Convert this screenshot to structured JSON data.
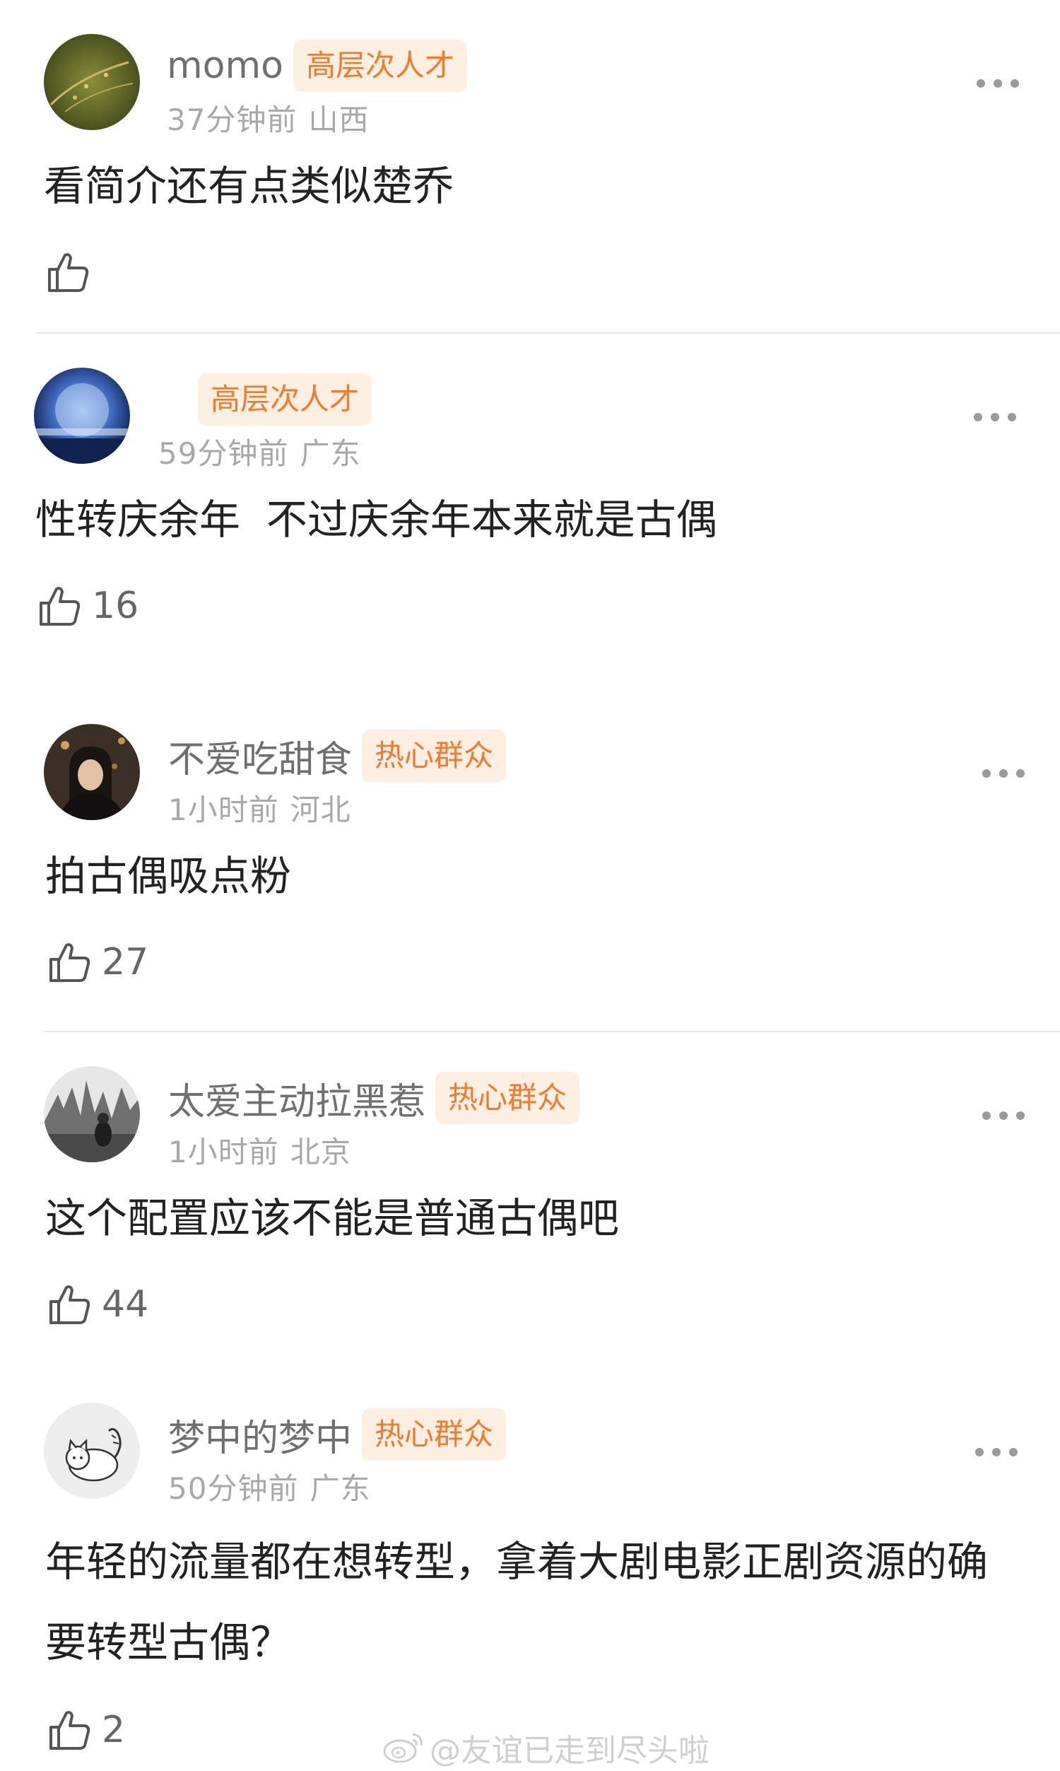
{
  "comments": [
    {
      "username": "momo",
      "badge": "高层次人才",
      "time": "37分钟前",
      "location": "山西",
      "text": "看简介还有点类似楚乔",
      "likes": "",
      "avatar_icon": "avatar-photo"
    },
    {
      "username": "",
      "badge": "高层次人才",
      "time": "59分钟前",
      "location": "广东",
      "text": "性转庆余年  不过庆余年本来就是古偶",
      "likes": "16",
      "avatar_icon": "avatar-photo"
    },
    {
      "username": "不爱吃甜食",
      "badge": "热心群众",
      "time": "1小时前",
      "location": "河北",
      "text": "拍古偶吸点粉",
      "likes": "27",
      "avatar_icon": "avatar-photo"
    },
    {
      "username": "太爱主动拉黑惹",
      "badge": "热心群众",
      "time": "1小时前",
      "location": "北京",
      "text": "这个配置应该不能是普通古偶吧",
      "likes": "44",
      "avatar_icon": "avatar-photo"
    },
    {
      "username": "梦中的梦中",
      "badge": "热心群众",
      "time": "50分钟前",
      "location": "广东",
      "text": "年轻的流量都在想转型，拿着大剧电影正剧资源的确要转型古偶？",
      "likes": "2",
      "avatar_icon": "avatar-cartoon-cat"
    }
  ],
  "watermark": "@友谊已走到尽头啦",
  "colors": {
    "badge_bg": "#fdeee2",
    "badge_text": "#f27a2c",
    "meta_text": "#a8a8a8",
    "username_text": "#6f6f6f"
  },
  "icons": {
    "like": "thumbs-up-icon",
    "more": "more-options-icon",
    "watermark_logo": "weibo-logo"
  }
}
